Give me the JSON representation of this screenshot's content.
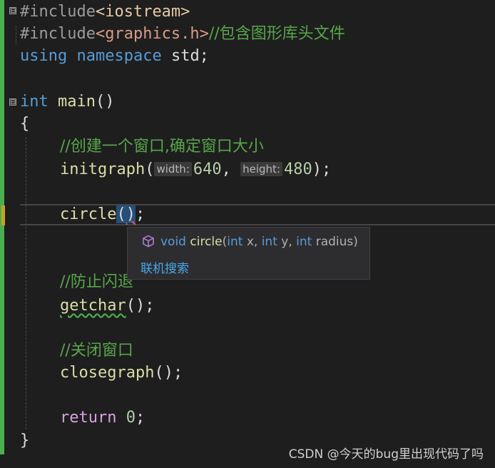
{
  "code": {
    "line1": {
      "pp": "#include",
      "file": "<iostream>"
    },
    "line2": {
      "pp": "#include",
      "file": "<graphics.h>",
      "comment": "//包含图形库头文件"
    },
    "line3": {
      "kw_using": "using",
      "kw_namespace": "namespace",
      "rest": " std;"
    },
    "line5": {
      "kw": "int",
      "fn": "main",
      "punc": "()"
    },
    "line6": {
      "text": "{"
    },
    "line7": {
      "comment": "//创建一个窗口,确定窗口大小"
    },
    "line8": {
      "fn": "initgraph",
      "open": "(",
      "hint_width": "width:",
      "arg1": "640",
      "sep": ", ",
      "hint_height": "height:",
      "arg2": "480",
      "close": ");"
    },
    "line10": {
      "fn": "circle",
      "open": "(",
      "close": ")",
      "semi": ";"
    },
    "line13": {
      "comment": "//防止闪退"
    },
    "line14": {
      "fn": "getchar",
      "rest": "();"
    },
    "line16": {
      "comment": "//关闭窗口"
    },
    "line17": {
      "fn": "closegraph",
      "rest": "();"
    },
    "line19": {
      "kw": "return",
      "sp": " ",
      "num": "0",
      "semi": ";"
    },
    "line20": {
      "text": "}"
    }
  },
  "tooltip": {
    "ret_type": "void",
    "fn_name": "circle",
    "open": "(",
    "p1_type": "int",
    "p1_name": " x, ",
    "p2_type": "int",
    "p2_name": " y, ",
    "p3_type": "int",
    "p3_name": " radius",
    "close": ")",
    "link": "联机搜索",
    "icon": "cube-icon"
  },
  "fold_markers": [
    "⊟",
    "⊟"
  ],
  "watermark": "CSDN @今天的bug里出现代码了吗",
  "colors": {
    "background": "#1e1e1e",
    "gutter_green": "#4caf50",
    "keyword": "#569cd6",
    "control_keyword": "#d8a0df",
    "comment": "#57a64a",
    "function": "#dcdcaa",
    "number": "#b5cea8",
    "link": "#4aa8e8"
  }
}
